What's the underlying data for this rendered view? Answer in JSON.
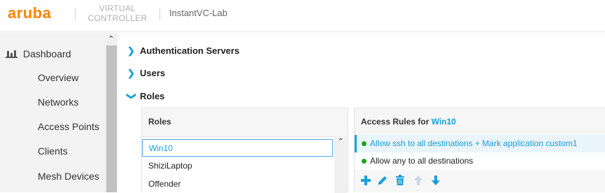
{
  "header": {
    "logo": "aruba",
    "product_line1": "VIRTUAL",
    "product_line2": "CONTROLLER",
    "cluster_name": "InstantVC-Lab"
  },
  "sidebar": {
    "dashboard": "Dashboard",
    "items": [
      "Overview",
      "Networks",
      "Access Points",
      "Clients",
      "Mesh Devices"
    ]
  },
  "main": {
    "sections": [
      "Authentication Servers",
      "Users",
      "Roles"
    ],
    "roles_panel": {
      "title": "Roles",
      "roles": [
        "Win10",
        "ShiziLaptop",
        "Offender"
      ],
      "selected": "Win10"
    },
    "rules_panel": {
      "title_prefix": "Access Rules for ",
      "title_role": "Win10",
      "rules": [
        "Allow ssh to all destinations + Mark application custom1",
        "Allow any to all destinations"
      ],
      "toolbar_icons": [
        "add-icon",
        "edit-icon",
        "delete-icon",
        "move-up-icon",
        "move-down-icon"
      ]
    }
  },
  "colors": {
    "brand": "#ff8300",
    "accent": "#1a9fd9",
    "status_green": "#1ea51e"
  }
}
